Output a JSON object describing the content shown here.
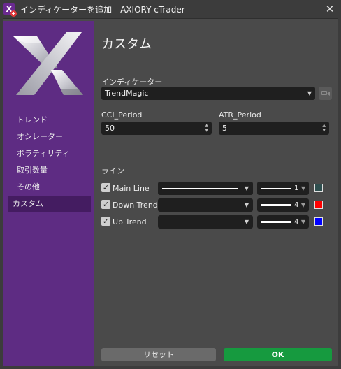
{
  "window": {
    "title": "インディケーターを追加 - AXIORY cTrader",
    "close_glyph": "✕"
  },
  "sidebar": {
    "items": [
      {
        "label": "トレンド",
        "active": false
      },
      {
        "label": "オシレーター",
        "active": false
      },
      {
        "label": "ボラティリティ",
        "active": false
      },
      {
        "label": "取引数量",
        "active": false
      },
      {
        "label": "その他",
        "active": false
      },
      {
        "label": "カスタム",
        "active": true
      }
    ]
  },
  "panel": {
    "title": "カスタム",
    "indicator_label": "インディケーター",
    "indicator_value": "TrendMagic",
    "params": [
      {
        "label": "CCI_Period",
        "value": "50"
      },
      {
        "label": "ATR_Period",
        "value": "5"
      }
    ],
    "lines_label": "ライン",
    "lines": [
      {
        "label": "Main Line",
        "checked": true,
        "width": "1",
        "color": "#2f4f4f"
      },
      {
        "label": "Down Trend",
        "checked": true,
        "width": "4",
        "color": "#ff0000"
      },
      {
        "label": "Up Trend",
        "checked": true,
        "width": "4",
        "color": "#0000ff"
      }
    ]
  },
  "buttons": {
    "reset": "リセット",
    "ok": "OK"
  },
  "colors": {
    "sidebar_bg": "#5e2c83",
    "ok_green": "#169a3f"
  }
}
